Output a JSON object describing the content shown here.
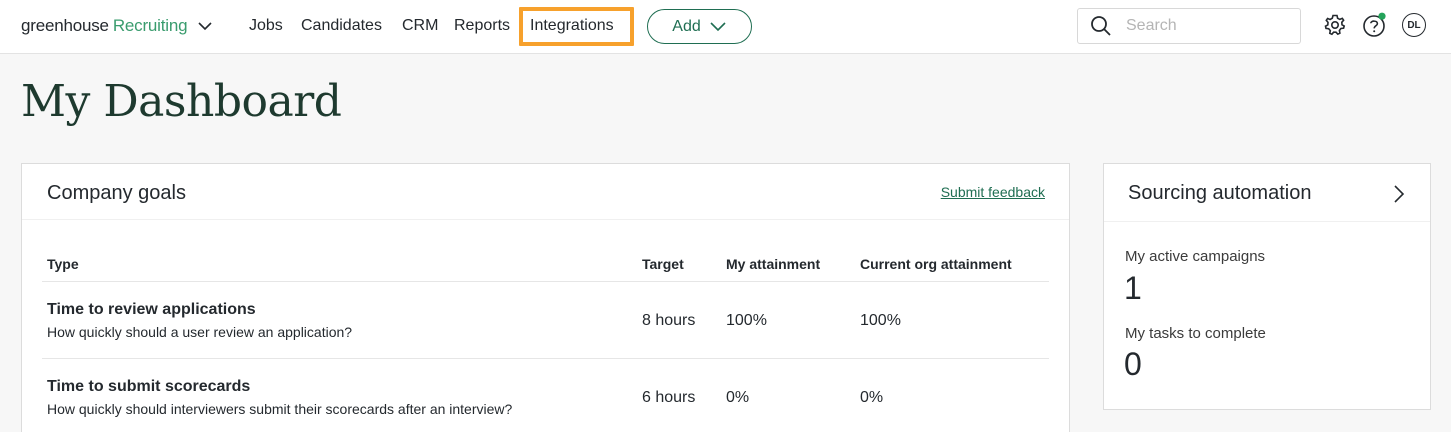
{
  "app": {
    "logo_main": "greenhouse",
    "logo_sub": "Recruiting"
  },
  "nav": {
    "items": [
      "Jobs",
      "Candidates",
      "CRM",
      "Reports",
      "Integrations"
    ],
    "add_label": "Add"
  },
  "search": {
    "placeholder": "Search"
  },
  "user": {
    "initials": "DL"
  },
  "page": {
    "title": "My Dashboard"
  },
  "goals": {
    "title": "Company goals",
    "feedback_link": "Submit feedback",
    "columns": [
      "Type",
      "Target",
      "My attainment",
      "Current org attainment"
    ],
    "rows": [
      {
        "title": "Time to review applications",
        "description": "How quickly should a user review an application?",
        "target": "8 hours",
        "my_attainment": "100%",
        "org_attainment": "100%"
      },
      {
        "title": "Time to submit scorecards",
        "description": "How quickly should interviewers submit their scorecards after an interview?",
        "target": "6 hours",
        "my_attainment": "0%",
        "org_attainment": "0%"
      }
    ]
  },
  "sourcing": {
    "title": "Sourcing automation",
    "metrics": [
      {
        "label": "My active campaigns",
        "value": "1"
      },
      {
        "label": "My tasks to complete",
        "value": "0"
      }
    ]
  },
  "colors": {
    "brand_green": "#3a9c6e",
    "dark_green": "#1f6e52",
    "highlight_orange": "#f7a12c",
    "notification_dot": "#24a35a"
  },
  "icons": [
    "chevron-down-icon",
    "search-icon",
    "gear-icon",
    "help-icon",
    "chevron-right-icon"
  ]
}
